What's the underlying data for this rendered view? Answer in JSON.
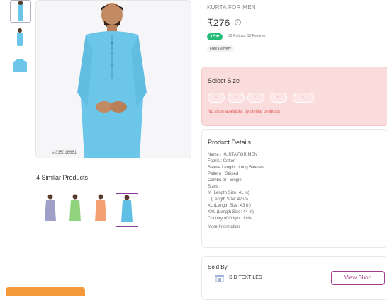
{
  "product": {
    "brand": "KURTA FOR MEN",
    "price": "₹276",
    "rating": "3.5★",
    "reviews": "38 Ratings, 15 Reviews",
    "delivery": "Free Delivery",
    "sku": "s-335016661"
  },
  "size_selector": {
    "title": "Select Size",
    "sizes": [
      "S",
      "M",
      "L",
      "XL",
      "XXL"
    ],
    "message": "No sizes available, try similar products"
  },
  "details": {
    "title": "Product Details",
    "lines": [
      "Name : KURTA FOR MEN",
      "Fabric : Cotton",
      "Sleeve Length : Long Sleeves",
      "Pattern : Striped",
      "Combo of : Single",
      "Sizes :",
      "M (Length Size: 41 in)",
      "L (Length Size: 42 in)",
      "XL (Length Size: 43 in)",
      "XXL (Length Size: 44 in)",
      "Country of Origin : India"
    ],
    "more": "More Information"
  },
  "similar": {
    "title": "4 Similar Products",
    "colors": [
      "#9fa0c8",
      "#8fd47c",
      "#f3a172",
      "#61bfe6"
    ]
  },
  "seller": {
    "title": "Sold By",
    "name": "S D TEXTILES",
    "button": "View Shop"
  },
  "colors": {
    "kurta": "#6cc6ea",
    "accent": "#a33c8c",
    "rating_green": "#23bb75",
    "size_card_bg": "#fadcdc",
    "cta_orange": "#f59a3a"
  }
}
